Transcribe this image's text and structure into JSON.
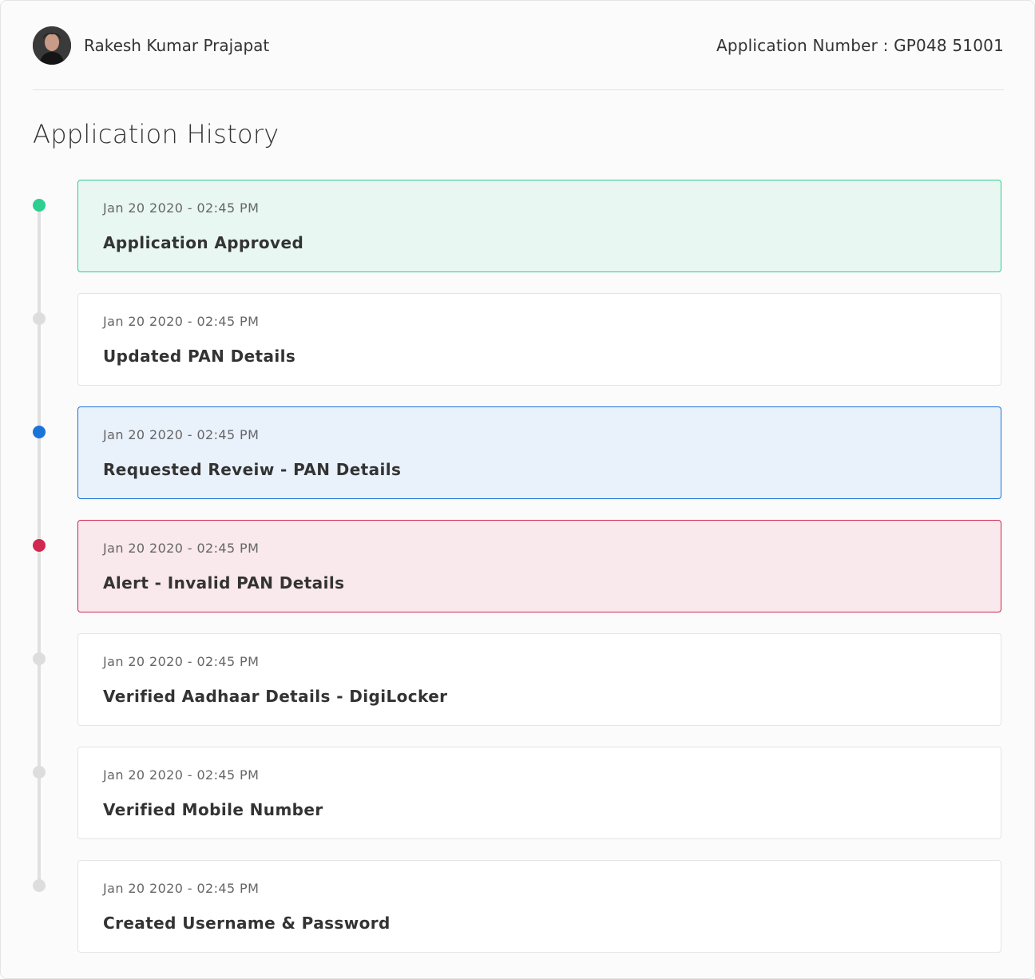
{
  "user": {
    "name": "Rakesh Kumar Prajapat"
  },
  "application": {
    "number_text": "Application Number : GP048 51001"
  },
  "page": {
    "title": "Application History"
  },
  "colors": {
    "approved": "#2ccf8f",
    "review": "#1a73d9",
    "alert": "#d0284f",
    "neutral": "#dddddd"
  },
  "history": [
    {
      "date": "Jan 20 2020 - 02:45 PM",
      "title": "Application Approved",
      "status": "success"
    },
    {
      "date": "Jan 20 2020 - 02:45 PM",
      "title": "Updated PAN Details",
      "status": "neutral"
    },
    {
      "date": "Jan 20 2020 - 02:45 PM",
      "title": "Requested Reveiw - PAN Details",
      "status": "info"
    },
    {
      "date": "Jan 20 2020 - 02:45 PM",
      "title": "Alert - Invalid PAN Details",
      "status": "danger"
    },
    {
      "date": "Jan 20 2020 - 02:45 PM",
      "title": "Verified Aadhaar Details - DigiLocker",
      "status": "neutral"
    },
    {
      "date": "Jan 20 2020 - 02:45 PM",
      "title": "Verified Mobile Number",
      "status": "neutral"
    },
    {
      "date": "Jan 20 2020 - 02:45 PM",
      "title": "Created Username & Password",
      "status": "neutral"
    }
  ]
}
